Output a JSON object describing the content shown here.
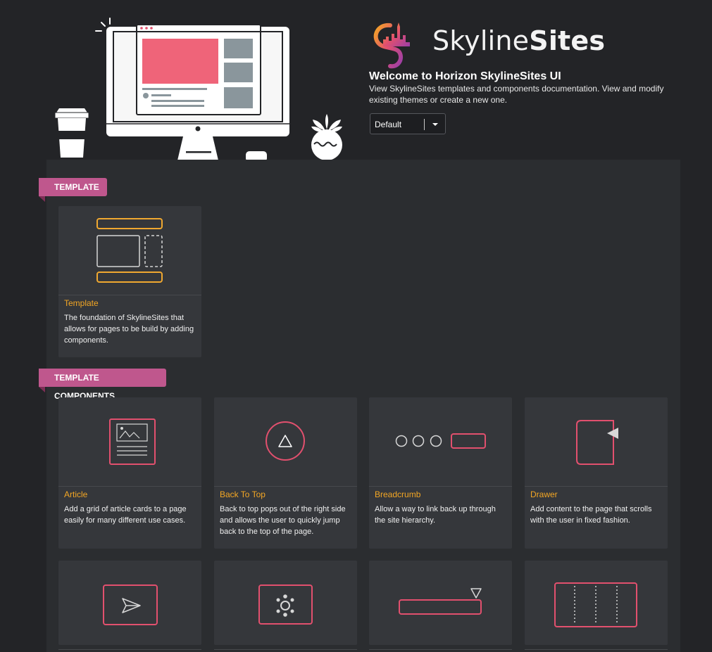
{
  "brand": {
    "name_light": "Skyline",
    "name_bold": "Sites"
  },
  "welcome": {
    "title": "Welcome to Horizon SkylineSites UI",
    "description": "View SkylineSites templates and components documentation. View and modify existing themes or create a new one."
  },
  "theme_select": {
    "value": "Default"
  },
  "sections": {
    "template": {
      "label": "TEMPLATE"
    },
    "template_components": {
      "label": "TEMPLATE COMPONENTS"
    }
  },
  "cards": {
    "template": {
      "title": "Template",
      "desc": "The foundation of SkylineSites that allows for pages to be build by adding components."
    },
    "article": {
      "title": "Article",
      "desc": "Add a grid of article cards to a page easily for many different use cases."
    },
    "back_to_top": {
      "title": "Back To Top",
      "desc": "Back to top pops out of the right side and allows the user to quickly jump back to the top of the page."
    },
    "breadcrumb": {
      "title": "Breadcrumb",
      "desc": "Allow a way to link back up through the site hierarchy."
    },
    "drawer": {
      "title": "Drawer",
      "desc": "Add content to the page that scrolls with the user in fixed fashion."
    }
  },
  "colors": {
    "background": "#232427",
    "panel": "#2b2d30",
    "card": "#35373b",
    "accent_title": "#f4a724",
    "ribbon": "#bf578d",
    "icon_pink": "#e2506e",
    "icon_yellow": "#f0a830"
  }
}
